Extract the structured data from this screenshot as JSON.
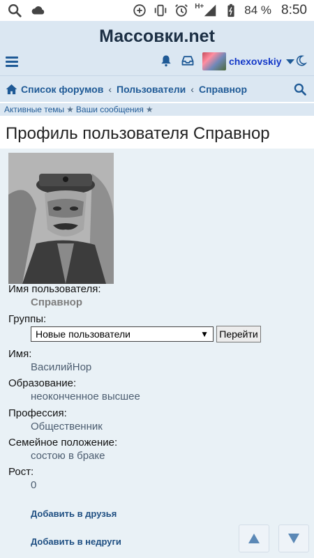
{
  "status_bar": {
    "battery": "84 %",
    "clock": "8:50",
    "network": "H+"
  },
  "header": {
    "site_title": "Массовки.net",
    "username": "chexovskiy"
  },
  "breadcrumb": {
    "items": [
      "Список форумов",
      "Пользователи",
      "Справнор"
    ],
    "separator": "‹"
  },
  "quicklinks": {
    "active_topics": "Активные темы",
    "your_messages": "Ваши сообщения",
    "star": "★"
  },
  "page": {
    "title": "Профиль пользователя Справнор"
  },
  "profile": {
    "username_label": "Имя пользователя:",
    "username_value": "Справнор",
    "groups_label": "Группы:",
    "groups_selected": "Новые пользователи",
    "go_button": "Перейти",
    "fields": [
      {
        "label": "Имя:",
        "value": "ВасилийНор"
      },
      {
        "label": "Образование:",
        "value": "неоконченное высшее"
      },
      {
        "label": "Профессия:",
        "value": "Общественник"
      },
      {
        "label": "Семейное положение:",
        "value": "состою в браке"
      },
      {
        "label": "Рост:",
        "value": "0"
      }
    ],
    "actions": {
      "add_friend": "Добавить в друзья",
      "add_foe": "Добавить в недруги"
    }
  },
  "icons": {
    "status_left": [
      "search-icon",
      "cloud-icon"
    ],
    "status_right": [
      "data-saver-icon",
      "vibrate-icon",
      "alarm-icon",
      "signal-icon",
      "battery-icon"
    ],
    "header": [
      "menu-icon",
      "bell-icon",
      "inbox-icon",
      "chevron-down-icon",
      "moon-icon"
    ],
    "breadcrumb": [
      "home-icon",
      "search-icon"
    ],
    "scroll": [
      "arrow-up-icon",
      "arrow-down-icon"
    ]
  },
  "colors": {
    "header_bg": "#dbe7f2",
    "link": "#1f5a96",
    "username": "#1338c8",
    "panel_bg": "#e9f1f6",
    "value_text": "#4c5d70"
  }
}
